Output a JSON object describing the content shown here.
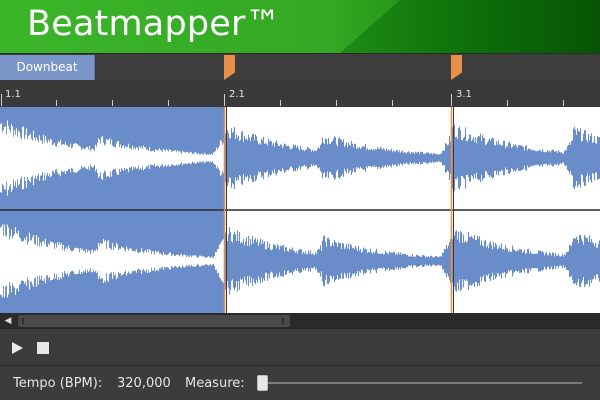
{
  "app": {
    "title": "Beatmapper™"
  },
  "markers": {
    "downbeat_label": "Downbeat",
    "flag_icons": [
      "marker-flag-icon",
      "marker-flag-icon"
    ]
  },
  "ruler": {
    "labels": [
      "1.1",
      "2.1",
      "3.1"
    ]
  },
  "transport": {
    "play_icon": "play-icon",
    "stop_icon": "stop-icon"
  },
  "footer": {
    "tempo_label": "Tempo (BPM):",
    "tempo_value": "320,000",
    "measure_label": "Measure:",
    "measure_position": 0.0
  },
  "colors": {
    "accent_green": "#3cb52a",
    "waveform_blue": "#6a8cc8",
    "selection_blue": "#7a96c8",
    "marker_orange": "#e8904a"
  }
}
